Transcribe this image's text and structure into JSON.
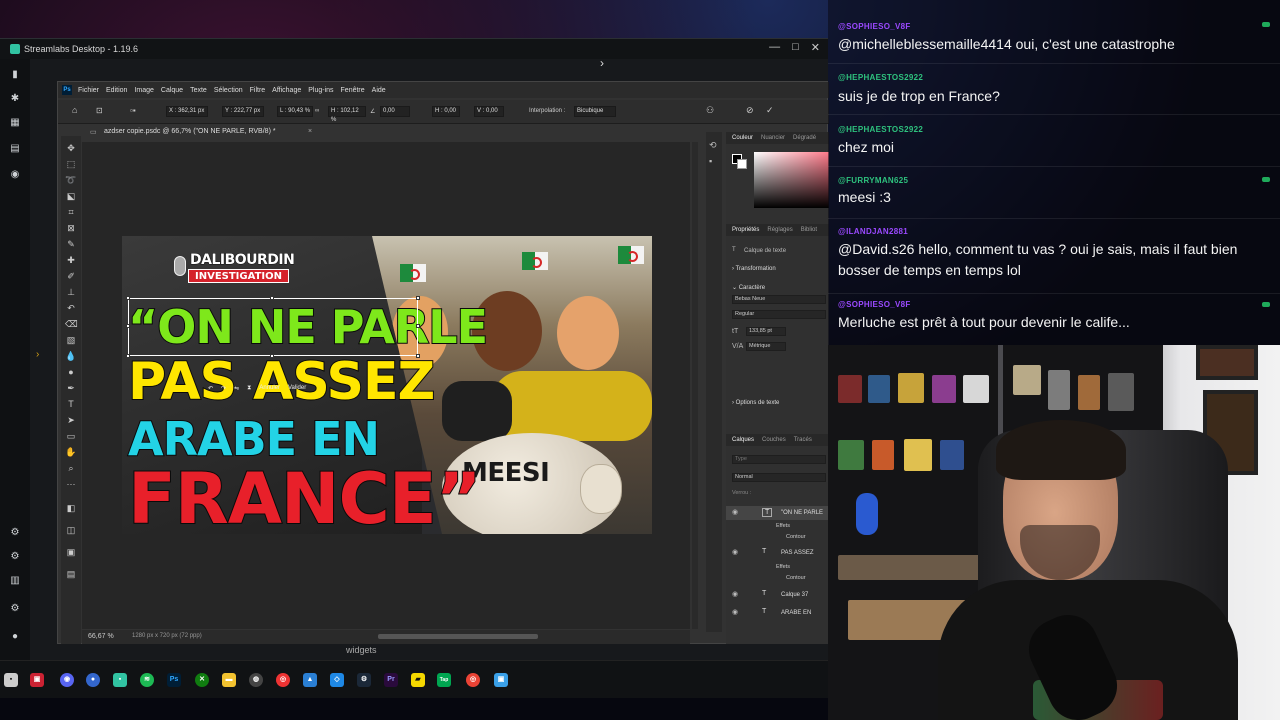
{
  "streamlabs": {
    "title": "Streamlabs Desktop - 1.19.6",
    "controls": [
      "—",
      "□",
      "✕"
    ],
    "taskbar_hover_label": "widgets"
  },
  "photoshop": {
    "menu": [
      "Fichier",
      "Edition",
      "Image",
      "Calque",
      "Texte",
      "Sélection",
      "Filtre",
      "Affichage",
      "Plug-ins",
      "Fenêtre",
      "Aide"
    ],
    "options": {
      "x": "X : 362,31 px",
      "y": "Y : 222,77 px",
      "w": "L : 90,43 %",
      "h": "H : 102,12 %",
      "angle": "0,00",
      "hskew": "H : 0,00",
      "vskew": "V : 0,00",
      "interpolation_label": "Interpolation :",
      "interpolation_value": "Bicubique"
    },
    "document_tab": "azdser copie.psdc @ 66,7% (\"ON NE PARLE, RVB/8) *",
    "status_zoom": "66,67 %",
    "status_size": "1280 px x 720 px (72 ppp)",
    "transform_bar": {
      "cancel": "Annuler",
      "validate": "Valider"
    },
    "panels": {
      "color_tabs": [
        "Couleur",
        "Nuancier",
        "Dégradé"
      ],
      "props_tabs": [
        "Propriétés",
        "Réglages",
        "Bibliot"
      ],
      "text_layer": "Calque de texte",
      "transformation": "Transformation",
      "character": "Caractère",
      "font": "Bebas Neue",
      "style": "Regular",
      "size": "133,85 pt",
      "kerning": "Métrique",
      "text_options": "Options de texte",
      "layers_tabs": [
        "Calques",
        "Couches",
        "Tracés"
      ],
      "filter_placeholder": "Type",
      "blend_mode": "Normal",
      "lock_label": "Verrou :",
      "layers": [
        {
          "name": "\"ON NE PARLE",
          "subs": [
            "Effets",
            "Contour"
          ]
        },
        {
          "name": "PAS ASSEZ",
          "subs": [
            "Effets",
            "Contour"
          ]
        },
        {
          "name": "Calque 37",
          "subs": []
        },
        {
          "name": "ARABE EN",
          "subs": []
        }
      ]
    }
  },
  "thumbnail": {
    "brand_top": "DALIBOURDIN",
    "brand_bottom": "INVESTIGATION",
    "line1": "“ON NE PARLE",
    "line2": "PAS ASSEZ",
    "line3": "ARABE EN",
    "line4": "FRANCE”",
    "sheep_label": "MEESI",
    "colors": {
      "line1": "#7ee81b",
      "line2": "#ffe600",
      "line3": "#23d3e6",
      "line4": "#e8202a"
    }
  },
  "chat": [
    {
      "user": "@SOPHIESO_V8F",
      "user_color": "#9a49ff",
      "text": "@michelleblessemaille4414 oui, c'est une catastrophe",
      "dot_color": "#1faa5b"
    },
    {
      "user": "@HEPHAESTOS2922",
      "user_color": "#2ec27e",
      "text": "suis je de trop en France?",
      "dot_color": ""
    },
    {
      "user": "@HEPHAESTOS2922",
      "user_color": "#2ec27e",
      "text": "chez moi",
      "dot_color": ""
    },
    {
      "user": "@FURRYMAN625",
      "user_color": "#2ec27e",
      "text": "meesi :3",
      "dot_color": "#1faa5b"
    },
    {
      "user": "@ILANDJAN2881",
      "user_color": "#9a49ff",
      "text": "@David.s26 hello, comment tu vas ? oui je sais, mais il faut bien bosser de temps en temps lol",
      "dot_color": ""
    },
    {
      "user": "@SOPHIESO_V8F",
      "user_color": "#9a49ff",
      "text": "Merluche est prêt à tout pour devenir le calife...",
      "dot_color": "#1faa5b"
    }
  ]
}
